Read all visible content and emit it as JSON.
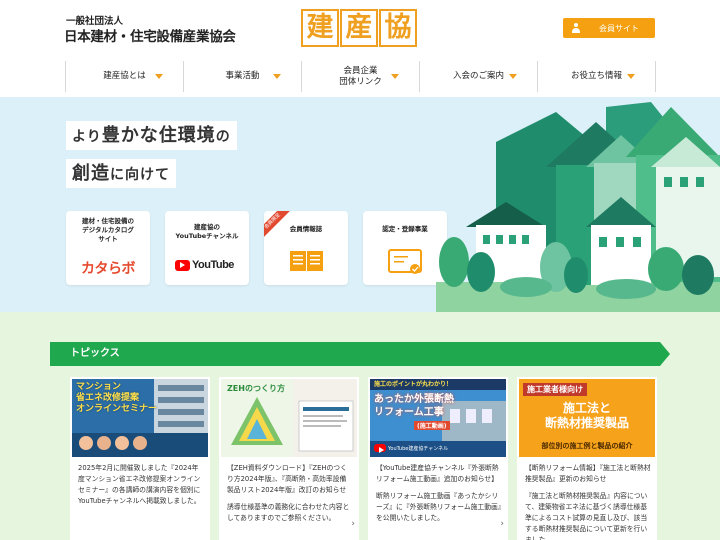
{
  "header": {
    "org_sub": "一般社団法人",
    "org_name": "日本建材・住宅設備産業協会",
    "logo_chars": [
      "建",
      "産",
      "協"
    ],
    "member_button": "会員サイト"
  },
  "nav": {
    "items": [
      {
        "label": "建産協とは"
      },
      {
        "label": "事業活動"
      },
      {
        "label": "会員企業\n団体リンク"
      },
      {
        "label": "入会のご案内"
      },
      {
        "label": "お役立ち情報"
      }
    ]
  },
  "hero": {
    "catch_line1_a": "より",
    "catch_line1_b": "豊かな住環境",
    "catch_line1_c": "の",
    "catch_line2_a": "創造",
    "catch_line2_b": "に向けて",
    "cards": [
      {
        "title": "建材・住宅設備の\nデジタルカタログ\nサイト",
        "brand": "カタらボ"
      },
      {
        "title": "建産協の\nYouTubeチャンネル",
        "brand": "YouTube"
      },
      {
        "title": "会員情報誌",
        "ribbon": "会員限定"
      },
      {
        "title": "認定・登録事業"
      }
    ]
  },
  "topics": {
    "title": "トピックス",
    "cards": [
      {
        "thumb_title": "マンション\n省エネ改修提案\nオンラインセミナー",
        "text": [
          "2025年2月に開催致しました『2024年度マンション省エネ改修提案オンラインセミナー』の各講師の講演内容を個別にYouTubeチャンネルへ掲載致しました。"
        ]
      },
      {
        "thumb_title": "ZEHのつくり方",
        "text": [
          "【ZEH資料ダウンロード】『ZEHのつくり方2024年版』、『高断熱・高効率設備 製品リスト2024年版』改訂のお知らせ",
          "誘導仕様基準の義務化に合わせた内容としてありますのでご参照ください。"
        ]
      },
      {
        "thumb_title": "あったか外張断熱\nリフォーム工事",
        "thumb_banner": "施工のポイントが丸わかり！",
        "thumb_sub": "(施工動画)",
        "thumb_caption": "YouTube建産協チャンネル",
        "text": [
          "【YouTube建産協チャンネル『外張断熱リフォーム施工動画』追加のお知らせ】",
          "断熱リフォーム施工動画『あったかシリーズ』に『外張断熱リフォーム施工動画』を公開いたしました。"
        ]
      },
      {
        "thumb_banner": "施工業者様向け",
        "thumb_title": "施工法と\n断熱材推奨製品",
        "thumb_sub": "部位別の施工例と製品の紹介",
        "text": [
          "【断熱リフォーム情報】『施工法と断熱材推奨製品』更新のお知らせ",
          "『施工法と断熱材推奨製品』内容について、建築物省エネ法に基づく誘導仕様基準によるコスト試算の見直し及び、該当する断熱材推奨製品について更新を行いました。"
        ]
      }
    ]
  },
  "colors": {
    "accent_orange": "#f5a010",
    "topics_green": "#1fa84e",
    "hero_bg": "#dcf0f9",
    "topics_bg": "#e6f5dd"
  }
}
